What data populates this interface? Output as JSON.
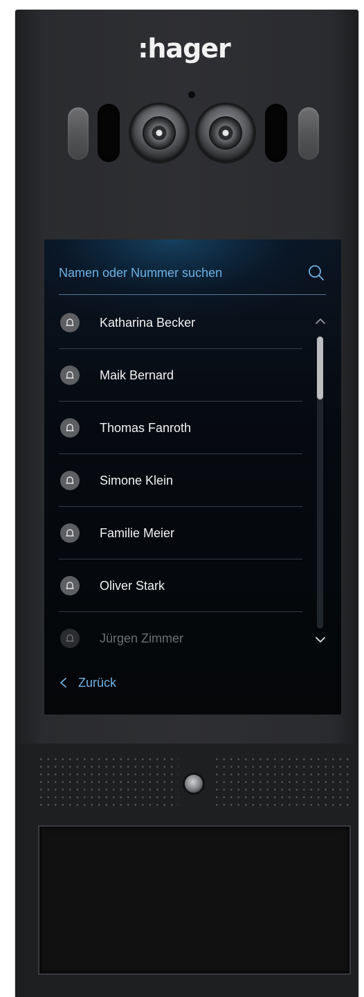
{
  "device": {
    "brand": ":hager",
    "colors": {
      "accent": "#6fb2e6",
      "panel": "#2e2f32",
      "screen": "#06090e"
    }
  },
  "screen": {
    "search": {
      "placeholder": "Namen oder Nummer suchen",
      "icon": "search-icon"
    },
    "list": {
      "items": [
        {
          "label": "Katharina Becker",
          "icon": "bell-icon",
          "faded": false
        },
        {
          "label": "Maik Bernard",
          "icon": "bell-icon",
          "faded": false
        },
        {
          "label": "Thomas Fanroth",
          "icon": "bell-icon",
          "faded": false
        },
        {
          "label": "Simone Klein",
          "icon": "bell-icon",
          "faded": false
        },
        {
          "label": "Familie Meier",
          "icon": "bell-icon",
          "faded": false
        },
        {
          "label": "Oliver Stark",
          "icon": "bell-icon",
          "faded": false
        },
        {
          "label": "Jürgen Zimmer",
          "icon": "bell-icon",
          "faded": true
        }
      ]
    },
    "scroll": {
      "up_icon": "chevron-up-icon",
      "down_icon": "chevron-down-icon",
      "position": 0
    },
    "back": {
      "label": "Zurück",
      "icon": "chevron-left-icon"
    }
  }
}
